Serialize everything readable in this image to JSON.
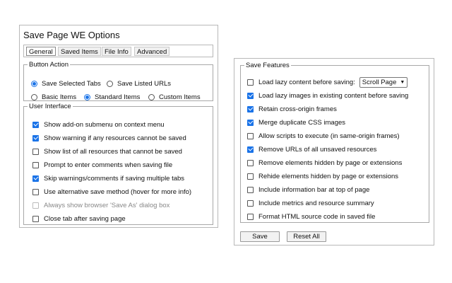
{
  "options": {
    "title": "Save Page WE Options",
    "tabs": [
      "General",
      "Saved Items",
      "File Info",
      "Advanced"
    ],
    "active_tab": "General",
    "button_action": {
      "legend": "Button Action",
      "save_selected_tabs": "Save Selected Tabs",
      "save_listed_urls": "Save Listed URLs",
      "basic_items": "Basic Items",
      "standard_items": "Standard Items",
      "custom_items": "Custom Items"
    },
    "user_interface": {
      "legend": "User Interface",
      "items": [
        "Show add-on submenu on context menu",
        "Show warning if any resources cannot be saved",
        "Show list of all resources that cannot be saved",
        "Prompt to enter comments when saving file",
        "Skip warnings/comments if saving multiple tabs",
        "Use alternative save method (hover for more info)",
        "Always show browser 'Save As' dialog box",
        "Close tab after saving page"
      ]
    }
  },
  "save_features": {
    "legend": "Save Features",
    "lazy_select_value": "Scroll Page",
    "items": [
      "Load lazy content before saving:",
      "Load lazy images in existing content before saving",
      "Retain cross-origin frames",
      "Merge duplicate CSS images",
      "Allow scripts to execute (in same-origin frames)",
      "Remove URLs of all unsaved resources",
      "Remove elements hidden by page or extensions",
      "Rehide elements hidden by page or extensions",
      "Include information bar at top of page",
      "Include metrics and resource summary",
      "Format HTML source code in saved file"
    ]
  },
  "buttons": {
    "save": "Save",
    "reset_all": "Reset All"
  },
  "colors": {
    "accent": "#1a73e8",
    "border": "#a8a8a8"
  }
}
